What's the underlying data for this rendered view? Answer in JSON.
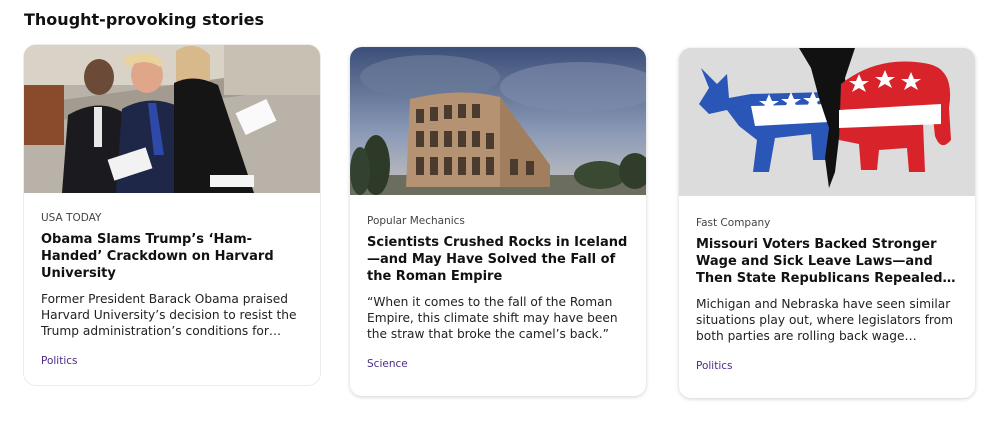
{
  "section": {
    "title": "Thought-provoking stories"
  },
  "cards": [
    {
      "source": "USA TODAY",
      "headline": "Obama Slams Trump’s ‘Ham-Handed’ Crackdown on Harvard University",
      "summary": "Former President Barack Obama praised Harvard University’s decision to resist the Trump administration’s conditions for…",
      "category": "Politics",
      "image": "three-people-seated-at-ceremony-photo"
    },
    {
      "source": "Popular Mechanics",
      "headline": "Scientists Crushed Rocks in Iceland—and May Have Solved the Fall of the Roman Empire",
      "summary": "“When it comes to the fall of the Roman Empire, this climate shift may have been the straw that broke the camel’s back.”",
      "category": "Science",
      "image": "colosseum-photo"
    },
    {
      "source": "Fast Company",
      "headline": "Missouri Voters Backed Stronger Wage and Sick Leave Laws—and Then State Republicans Repealed…",
      "summary": "Michigan and Nebraska have seen similar situations play out, where legislators from both parties are rolling back wage…",
      "category": "Politics",
      "image": "donkey-and-elephant-illustration"
    }
  ],
  "colors": {
    "category_link": "#4b2a86",
    "democrat_blue": "#2a56b8",
    "republican_red": "#d8232a"
  }
}
